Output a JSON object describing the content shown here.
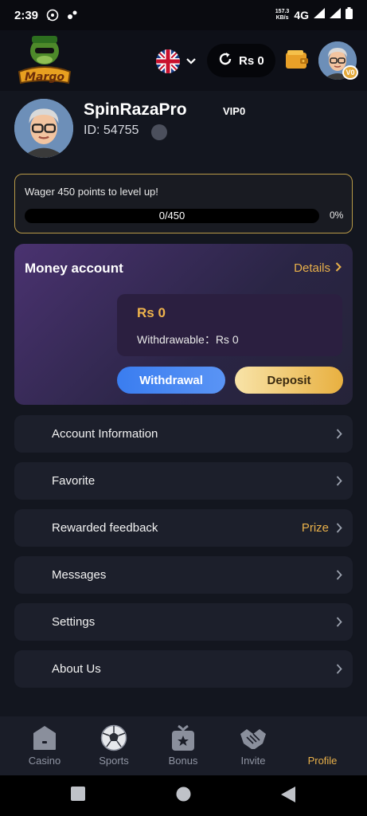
{
  "status_bar": {
    "time": "2:39",
    "speed_value": "157.3",
    "speed_unit": "KB/s",
    "network": "4G"
  },
  "header": {
    "logo_text": "Margo",
    "balance": "Rs 0",
    "vip_badge": "V0"
  },
  "profile": {
    "username": "SpinRazaPro",
    "vip_level": "VIP0",
    "user_id": "ID: 54755"
  },
  "wager": {
    "message": "Wager 450 points to level up!",
    "progress_label": "0/450",
    "percent": "0%",
    "progress_value": 0
  },
  "money_account": {
    "title": "Money account",
    "details_label": "Details",
    "balance": "Rs 0",
    "withdrawable": "Withdrawable：Rs 0",
    "withdraw_label": "Withdrawal",
    "deposit_label": "Deposit"
  },
  "menu": [
    {
      "label": "Account Information",
      "extra": ""
    },
    {
      "label": "Favorite",
      "extra": ""
    },
    {
      "label": "Rewarded feedback",
      "extra": "Prize"
    },
    {
      "label": "Messages",
      "extra": ""
    },
    {
      "label": "Settings",
      "extra": ""
    },
    {
      "label": "About Us",
      "extra": ""
    }
  ],
  "tabs": [
    {
      "label": "Casino",
      "icon": "casino-icon",
      "active": false
    },
    {
      "label": "Sports",
      "icon": "soccer-ball-icon",
      "active": false
    },
    {
      "label": "Bonus",
      "icon": "gift-icon",
      "active": false
    },
    {
      "label": "Invite",
      "icon": "handshake-icon",
      "active": false
    },
    {
      "label": "Profile",
      "icon": "profile-icon",
      "active": true
    }
  ],
  "colors": {
    "accent_gold": "#e8b04a",
    "primary_blue": "#3a7df0",
    "background": "#13161f",
    "card": "#1c1f2b"
  }
}
